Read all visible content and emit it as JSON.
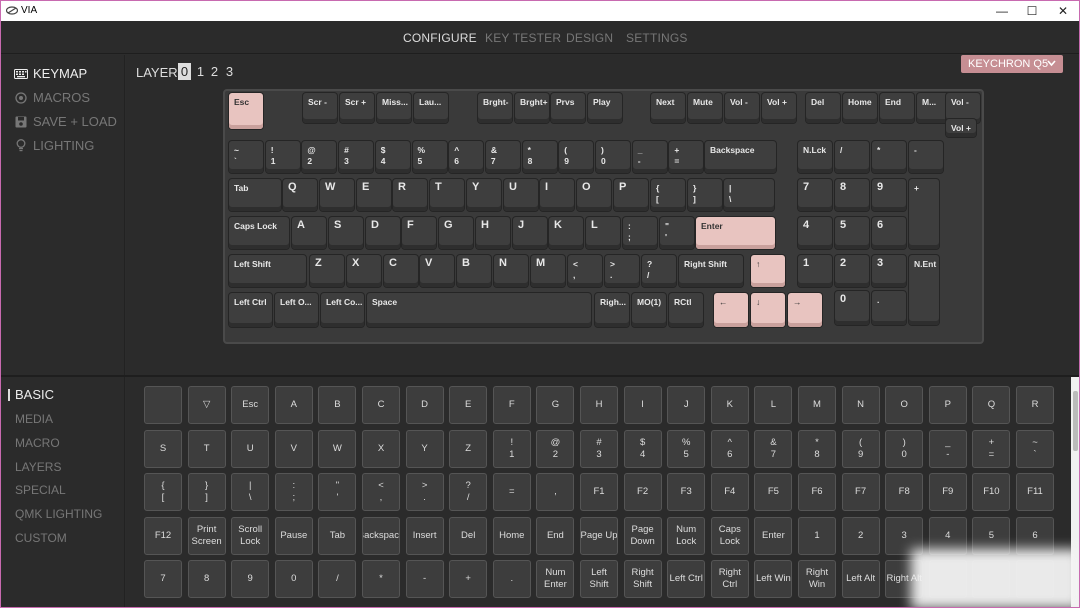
{
  "window": {
    "title": "VIA",
    "minimize": "—",
    "maximize": "☐",
    "close": "✕"
  },
  "nav": {
    "tabs": [
      "CONFIGURE",
      "KEY TESTER",
      "DESIGN",
      "SETTINGS"
    ],
    "active": 0
  },
  "sidebar": {
    "items": [
      {
        "label": "KEYMAP",
        "icon": "keyboard-icon"
      },
      {
        "label": "MACROS",
        "icon": "record-icon"
      },
      {
        "label": "SAVE + LOAD",
        "icon": "save-icon"
      },
      {
        "label": "LIGHTING",
        "icon": "lightbulb-icon"
      }
    ]
  },
  "layer": {
    "label": "LAYER",
    "options": [
      "0",
      "1",
      "2",
      "3"
    ],
    "active": 0
  },
  "keyboard": {
    "name": "KEYCHRON Q5"
  },
  "colors": {
    "accent": "#c68e93",
    "pink_key": "#e8c4c0",
    "dark_key": "#3e3e3e"
  },
  "keys": {
    "r0": [
      "Esc",
      "Scr -",
      "Scr +",
      "Miss...",
      "Lau...",
      "Brght-",
      "Brght+",
      "Prvs",
      "Play",
      "Next",
      "Mute",
      "Vol -",
      "Vol +",
      "Del",
      "Home",
      "End",
      "M...",
      "Vol -",
      "Vol +"
    ],
    "r1": [
      "~\n`",
      "!\n1",
      "@\n2",
      "#\n3",
      "$\n4",
      "%\n5",
      "^\n6",
      "&\n7",
      "*\n8",
      "(\n9",
      ")\n0",
      "_\n-",
      "+\n=",
      "Backspace",
      "N.Lck",
      "/",
      "*",
      "-"
    ],
    "r2": [
      "Tab",
      "Q",
      "W",
      "E",
      "R",
      "T",
      "Y",
      "U",
      "I",
      "O",
      "P",
      "{\n[",
      "}\n]",
      "|\n\\",
      "7",
      "8",
      "9",
      "+"
    ],
    "r3": [
      "Caps Lock",
      "A",
      "S",
      "D",
      "F",
      "G",
      "H",
      "J",
      "K",
      "L",
      ":\n;",
      "\"\n'",
      "Enter",
      "4",
      "5",
      "6"
    ],
    "r4": [
      "Left Shift",
      "Z",
      "X",
      "C",
      "V",
      "B",
      "N",
      "M",
      "<\n,",
      ">\n.",
      "?\n/",
      "Right Shift",
      "↑",
      "1",
      "2",
      "3",
      "N.Ent"
    ],
    "r5": [
      "Left Ctrl",
      "Left O...",
      "Left Co...",
      "Space",
      "Righ...",
      "MO(1)",
      "RCtl",
      "←",
      "↓",
      "→",
      "0",
      "."
    ]
  },
  "bottom_sidebar": {
    "items": [
      "BASIC",
      "MEDIA",
      "MACRO",
      "LAYERS",
      "SPECIAL",
      "QMK LIGHTING",
      "CUSTOM"
    ],
    "active": 0
  },
  "keycodes": {
    "row1": [
      "",
      "▽",
      "Esc",
      "A",
      "B",
      "C",
      "D",
      "E",
      "F",
      "G",
      "H",
      "I",
      "J",
      "K",
      "L",
      "M",
      "N",
      "O",
      "P",
      "Q",
      "R"
    ],
    "row2": [
      "S",
      "T",
      "U",
      "V",
      "W",
      "X",
      "Y",
      "Z",
      "!\n1",
      "@\n2",
      "#\n3",
      "$\n4",
      "%\n5",
      "^\n6",
      "&\n7",
      "*\n8",
      "(\n9",
      ")\n0",
      "_\n-",
      "+\n=",
      "~\n`"
    ],
    "row3": [
      "{\n[",
      "}\n]",
      "|\n\\",
      ":\n;",
      "\"\n'",
      "<\n,",
      ">\n.",
      "?\n/",
      "=",
      ",",
      "F1",
      "F2",
      "F3",
      "F4",
      "F5",
      "F6",
      "F7",
      "F8",
      "F9",
      "F10",
      "F11"
    ],
    "row4": [
      "F12",
      "Print\nScreen",
      "Scroll\nLock",
      "Pause",
      "Tab",
      "Backspace",
      "Insert",
      "Del",
      "Home",
      "End",
      "Page Up",
      "Page\nDown",
      "Num\nLock",
      "Caps\nLock",
      "Enter",
      "1",
      "2",
      "3",
      "4",
      "5",
      "6"
    ],
    "row5": [
      "7",
      "8",
      "9",
      "0",
      "/",
      "*",
      "-",
      "+",
      ".",
      "Num\nEnter",
      "Left\nShift",
      "Right\nShift",
      "Left Ctrl",
      "Right\nCtrl",
      "Left Win",
      "Right\nWin",
      "Left Alt",
      "Right Alt",
      "",
      "",
      ""
    ]
  }
}
